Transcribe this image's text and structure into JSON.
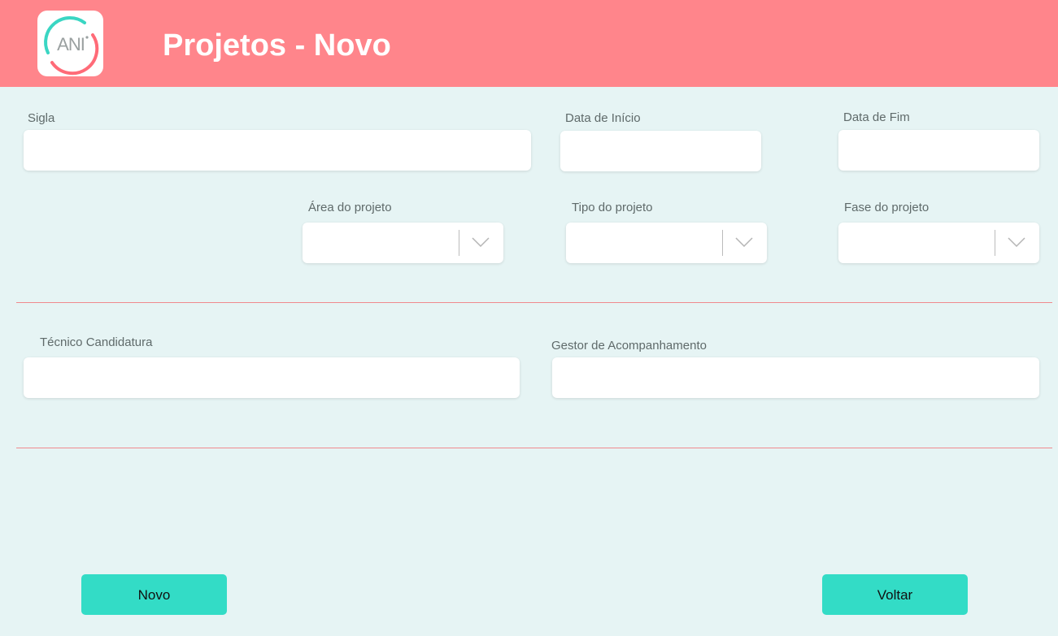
{
  "header": {
    "title": "Projetos - Novo",
    "logo_text": "ANI",
    "background_color": "#ff858b"
  },
  "form": {
    "sigla": {
      "label": "Sigla",
      "value": ""
    },
    "data_inicio": {
      "label": "Data de Início",
      "value": ""
    },
    "data_fim": {
      "label": "Data de Fim",
      "value": ""
    },
    "area_projeto": {
      "label": "Área do projeto",
      "value": ""
    },
    "tipo_projeto": {
      "label": "Tipo do projeto",
      "value": ""
    },
    "fase_projeto": {
      "label": "Fase do projeto",
      "value": ""
    },
    "tecnico_candidatura": {
      "label": "Técnico Candidatura",
      "value": ""
    },
    "gestor_acompanhamento": {
      "label": "Gestor de Acompanhamento",
      "value": ""
    }
  },
  "buttons": {
    "novo": "Novo",
    "voltar": "Voltar"
  },
  "colors": {
    "page_background": "#e6f4f4",
    "divider": "#f08a8e",
    "button": "#33dcc6"
  }
}
